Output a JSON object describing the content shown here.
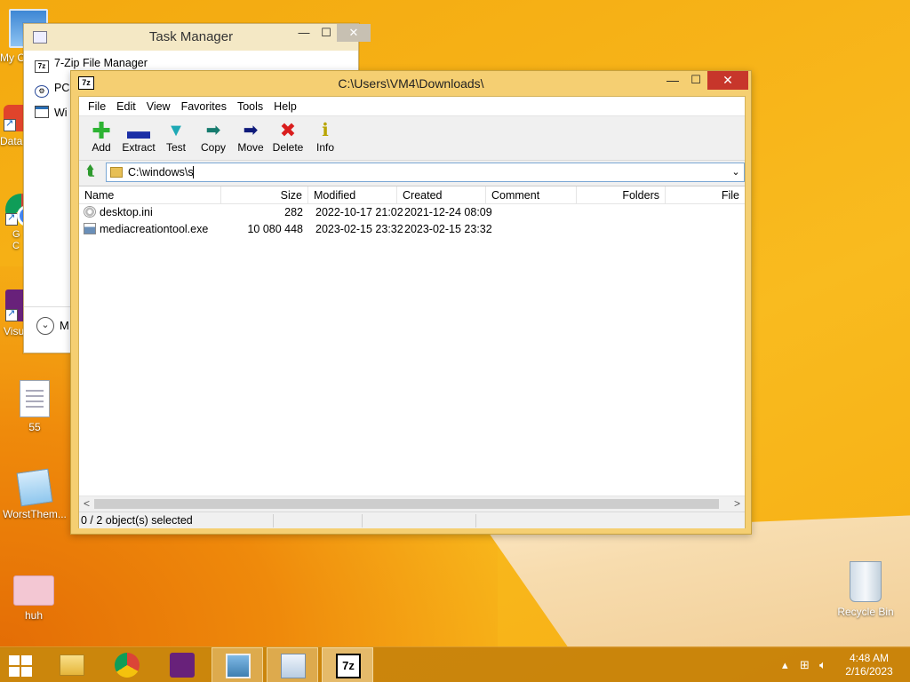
{
  "desktop": {
    "icons": [
      {
        "label": "My C",
        "icon": "computer-icon"
      },
      {
        "label": "Data",
        "icon": "data-app-icon"
      },
      {
        "label": "G\nC",
        "icon": "chrome-icon"
      },
      {
        "label": "Visu",
        "icon": "visual-studio-icon"
      },
      {
        "label": "55",
        "icon": "text-file-icon"
      },
      {
        "label": "WorstThem...",
        "icon": "notepad-file-icon"
      },
      {
        "label": "huh",
        "icon": "image-file-icon"
      },
      {
        "label": "Recycle Bin",
        "icon": "recycle-bin-icon"
      }
    ]
  },
  "task_manager": {
    "title": "Task Manager",
    "controls": {
      "minimize": "—",
      "maximize": "☐",
      "close": "✕"
    },
    "processes": [
      {
        "label": "7-Zip File Manager",
        "icon": "7z"
      },
      {
        "label": "PC",
        "icon": "gear"
      },
      {
        "label": "Wi",
        "icon": "window"
      }
    ],
    "more_details": "M"
  },
  "zip_window": {
    "title": "C:\\Users\\VM4\\Downloads\\",
    "app_icon": "7z",
    "controls": {
      "minimize": "—",
      "maximize": "☐",
      "close": "✕"
    },
    "menu": [
      "File",
      "Edit",
      "View",
      "Favorites",
      "Tools",
      "Help"
    ],
    "toolbar": [
      {
        "label": "Add",
        "glyph": "✚"
      },
      {
        "label": "Extract",
        "glyph": "▬"
      },
      {
        "label": "Test",
        "glyph": "▼"
      },
      {
        "label": "Copy",
        "glyph": "➡"
      },
      {
        "label": "Move",
        "glyph": "➡"
      },
      {
        "label": "Delete",
        "glyph": "✖"
      },
      {
        "label": "Info",
        "glyph": "ℹ"
      }
    ],
    "address": {
      "value": "C:\\windows\\s",
      "dropdown": "⌄",
      "up_glyph": "⮬"
    },
    "columns": [
      "Name",
      "Size",
      "Modified",
      "Created",
      "Comment",
      "Folders",
      "File"
    ],
    "files": [
      {
        "name": "desktop.ini",
        "size": "282",
        "modified": "2022-10-17 21:02",
        "created": "2021-12-24 08:09",
        "icon": "settings-file-icon"
      },
      {
        "name": "mediacreationtool.exe",
        "size": "10 080 448",
        "modified": "2023-02-15 23:32",
        "created": "2023-02-15 23:32",
        "icon": "exe-file-icon"
      }
    ],
    "scroll": {
      "left": "<",
      "right": ">"
    },
    "status": "0 / 2 object(s) selected"
  },
  "taskbar": {
    "pinned": [
      "file-explorer-icon",
      "chrome-icon",
      "visual-studio-icon",
      "photos-icon",
      "task-manager-icon",
      "7zip-icon"
    ],
    "active_app": "7z",
    "time": "4:48 AM",
    "date": "2/16/2023"
  }
}
